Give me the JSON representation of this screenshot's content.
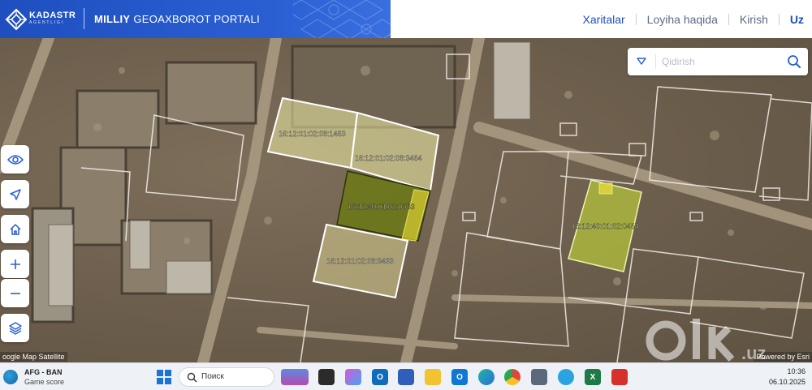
{
  "header": {
    "logo_text": "KADASTR",
    "logo_sub": "AGENTLIGI",
    "portal_title_bold": "MILLIY",
    "portal_title_rest": " GEOAXBOROT PORTALI",
    "nav": [
      {
        "label": "Xaritalar",
        "active": true
      },
      {
        "label": "Loyiha haqida",
        "active": false
      },
      {
        "label": "Kirish",
        "active": false
      }
    ],
    "language": "Uz",
    "brand_color": "#1f4fbf"
  },
  "search": {
    "placeholder": "Qidirish",
    "dropdown_icon": "triangle-down-icon",
    "button_icon": "search-icon"
  },
  "tools": [
    {
      "name": "eye-button",
      "icon": "eye-icon"
    },
    {
      "name": "locate-button",
      "icon": "navigation-arrow-icon"
    },
    {
      "name": "home-button",
      "icon": "home-icon"
    },
    {
      "name": "zoom-in-button",
      "icon": "plus-icon"
    },
    {
      "name": "zoom-out-button",
      "icon": "minus-icon"
    },
    {
      "name": "layers-button",
      "icon": "layers-icon"
    }
  ],
  "parcels": [
    {
      "id": "16:12:01:02:08:1463",
      "fill": "#f2f0a8"
    },
    {
      "id": "16:12:01:02:08:3464",
      "fill": "#f2f0a8"
    },
    {
      "id": "16:12:40:01:02:0583",
      "fill": "#6b7a12"
    },
    {
      "id": "16:12:01:02:08:3433",
      "fill": "#e6dc9a"
    },
    {
      "id": "16:12:40:01:02:0458",
      "fill": "#b8c93a"
    }
  ],
  "attribution": {
    "left": "oogle Map Satellite",
    "right": "Powered by Esri"
  },
  "watermark": "olx.uz",
  "taskbar": {
    "widget_title": "AFG - BAN",
    "widget_subtitle": "Game score",
    "search_label": "Поиск",
    "time": "10:36",
    "date": "06.10.2025"
  }
}
